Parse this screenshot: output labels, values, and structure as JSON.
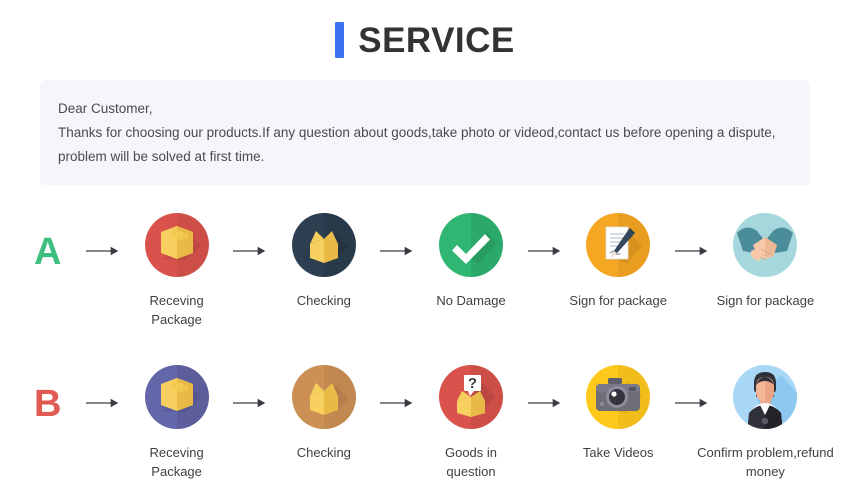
{
  "header": {
    "accent_color": "#3b72f0",
    "title": "SERVICE"
  },
  "notice": {
    "line1": "Dear Customer,",
    "line2": "Thanks for choosing our products.If any question about goods,take photo or videod,contact us before opening a dispute,",
    "line3": "problem will be solved at first time."
  },
  "flows": [
    {
      "letter": "A",
      "letter_color": "#3fbf7f",
      "steps": [
        {
          "label": "Receving Package",
          "icon": "closed-box-icon",
          "circle_color": "#d9534c"
        },
        {
          "label": "Checking",
          "icon": "open-box-icon",
          "circle_color": "#2c3e50"
        },
        {
          "label": "No Damage",
          "icon": "check-mark-icon",
          "circle_color": "#2fb673"
        },
        {
          "label": "Sign for package",
          "icon": "document-pen-icon",
          "circle_color": "#f5a623"
        },
        {
          "label": "Sign for package",
          "icon": "handshake-icon",
          "circle_color": "#a6d7dd"
        }
      ]
    },
    {
      "letter": "B",
      "letter_color": "#e05a53",
      "steps": [
        {
          "label": "Receving Package",
          "icon": "closed-box-icon",
          "circle_color": "#6366a8"
        },
        {
          "label": "Checking",
          "icon": "open-box-icon",
          "circle_color": "#cc9055"
        },
        {
          "label": "Goods in question",
          "icon": "question-box-icon",
          "circle_color": "#d9534c"
        },
        {
          "label": "Take Videos",
          "icon": "camera-icon",
          "circle_color": "#ffc91c"
        },
        {
          "label": "Confirm  problem,refund\nmoney",
          "icon": "person-avatar-icon",
          "circle_color": "#a8d8f5"
        }
      ]
    }
  ],
  "arrow": {
    "name": "arrow-right-icon",
    "color": "#3b3b44"
  }
}
